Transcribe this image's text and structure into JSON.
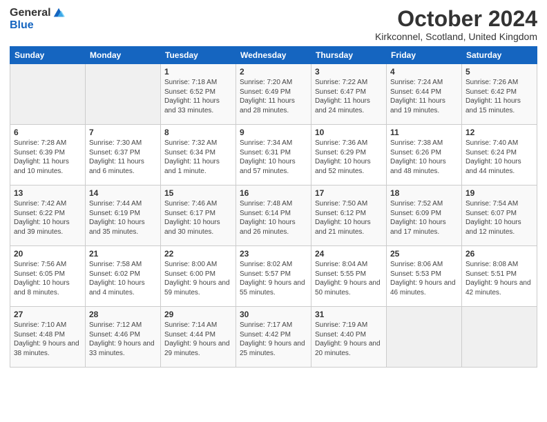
{
  "logo": {
    "general": "General",
    "blue": "Blue"
  },
  "title": "October 2024",
  "location": "Kirkconnel, Scotland, United Kingdom",
  "days_header": [
    "Sunday",
    "Monday",
    "Tuesday",
    "Wednesday",
    "Thursday",
    "Friday",
    "Saturday"
  ],
  "weeks": [
    [
      {
        "num": "",
        "detail": ""
      },
      {
        "num": "",
        "detail": ""
      },
      {
        "num": "1",
        "detail": "Sunrise: 7:18 AM\nSunset: 6:52 PM\nDaylight: 11 hours\nand 33 minutes."
      },
      {
        "num": "2",
        "detail": "Sunrise: 7:20 AM\nSunset: 6:49 PM\nDaylight: 11 hours\nand 28 minutes."
      },
      {
        "num": "3",
        "detail": "Sunrise: 7:22 AM\nSunset: 6:47 PM\nDaylight: 11 hours\nand 24 minutes."
      },
      {
        "num": "4",
        "detail": "Sunrise: 7:24 AM\nSunset: 6:44 PM\nDaylight: 11 hours\nand 19 minutes."
      },
      {
        "num": "5",
        "detail": "Sunrise: 7:26 AM\nSunset: 6:42 PM\nDaylight: 11 hours\nand 15 minutes."
      }
    ],
    [
      {
        "num": "6",
        "detail": "Sunrise: 7:28 AM\nSunset: 6:39 PM\nDaylight: 11 hours\nand 10 minutes."
      },
      {
        "num": "7",
        "detail": "Sunrise: 7:30 AM\nSunset: 6:37 PM\nDaylight: 11 hours\nand 6 minutes."
      },
      {
        "num": "8",
        "detail": "Sunrise: 7:32 AM\nSunset: 6:34 PM\nDaylight: 11 hours\nand 1 minute."
      },
      {
        "num": "9",
        "detail": "Sunrise: 7:34 AM\nSunset: 6:31 PM\nDaylight: 10 hours\nand 57 minutes."
      },
      {
        "num": "10",
        "detail": "Sunrise: 7:36 AM\nSunset: 6:29 PM\nDaylight: 10 hours\nand 52 minutes."
      },
      {
        "num": "11",
        "detail": "Sunrise: 7:38 AM\nSunset: 6:26 PM\nDaylight: 10 hours\nand 48 minutes."
      },
      {
        "num": "12",
        "detail": "Sunrise: 7:40 AM\nSunset: 6:24 PM\nDaylight: 10 hours\nand 44 minutes."
      }
    ],
    [
      {
        "num": "13",
        "detail": "Sunrise: 7:42 AM\nSunset: 6:22 PM\nDaylight: 10 hours\nand 39 minutes."
      },
      {
        "num": "14",
        "detail": "Sunrise: 7:44 AM\nSunset: 6:19 PM\nDaylight: 10 hours\nand 35 minutes."
      },
      {
        "num": "15",
        "detail": "Sunrise: 7:46 AM\nSunset: 6:17 PM\nDaylight: 10 hours\nand 30 minutes."
      },
      {
        "num": "16",
        "detail": "Sunrise: 7:48 AM\nSunset: 6:14 PM\nDaylight: 10 hours\nand 26 minutes."
      },
      {
        "num": "17",
        "detail": "Sunrise: 7:50 AM\nSunset: 6:12 PM\nDaylight: 10 hours\nand 21 minutes."
      },
      {
        "num": "18",
        "detail": "Sunrise: 7:52 AM\nSunset: 6:09 PM\nDaylight: 10 hours\nand 17 minutes."
      },
      {
        "num": "19",
        "detail": "Sunrise: 7:54 AM\nSunset: 6:07 PM\nDaylight: 10 hours\nand 12 minutes."
      }
    ],
    [
      {
        "num": "20",
        "detail": "Sunrise: 7:56 AM\nSunset: 6:05 PM\nDaylight: 10 hours\nand 8 minutes."
      },
      {
        "num": "21",
        "detail": "Sunrise: 7:58 AM\nSunset: 6:02 PM\nDaylight: 10 hours\nand 4 minutes."
      },
      {
        "num": "22",
        "detail": "Sunrise: 8:00 AM\nSunset: 6:00 PM\nDaylight: 9 hours\nand 59 minutes."
      },
      {
        "num": "23",
        "detail": "Sunrise: 8:02 AM\nSunset: 5:57 PM\nDaylight: 9 hours\nand 55 minutes."
      },
      {
        "num": "24",
        "detail": "Sunrise: 8:04 AM\nSunset: 5:55 PM\nDaylight: 9 hours\nand 50 minutes."
      },
      {
        "num": "25",
        "detail": "Sunrise: 8:06 AM\nSunset: 5:53 PM\nDaylight: 9 hours\nand 46 minutes."
      },
      {
        "num": "26",
        "detail": "Sunrise: 8:08 AM\nSunset: 5:51 PM\nDaylight: 9 hours\nand 42 minutes."
      }
    ],
    [
      {
        "num": "27",
        "detail": "Sunrise: 7:10 AM\nSunset: 4:48 PM\nDaylight: 9 hours\nand 38 minutes."
      },
      {
        "num": "28",
        "detail": "Sunrise: 7:12 AM\nSunset: 4:46 PM\nDaylight: 9 hours\nand 33 minutes."
      },
      {
        "num": "29",
        "detail": "Sunrise: 7:14 AM\nSunset: 4:44 PM\nDaylight: 9 hours\nand 29 minutes."
      },
      {
        "num": "30",
        "detail": "Sunrise: 7:17 AM\nSunset: 4:42 PM\nDaylight: 9 hours\nand 25 minutes."
      },
      {
        "num": "31",
        "detail": "Sunrise: 7:19 AM\nSunset: 4:40 PM\nDaylight: 9 hours\nand 20 minutes."
      },
      {
        "num": "",
        "detail": ""
      },
      {
        "num": "",
        "detail": ""
      }
    ]
  ]
}
